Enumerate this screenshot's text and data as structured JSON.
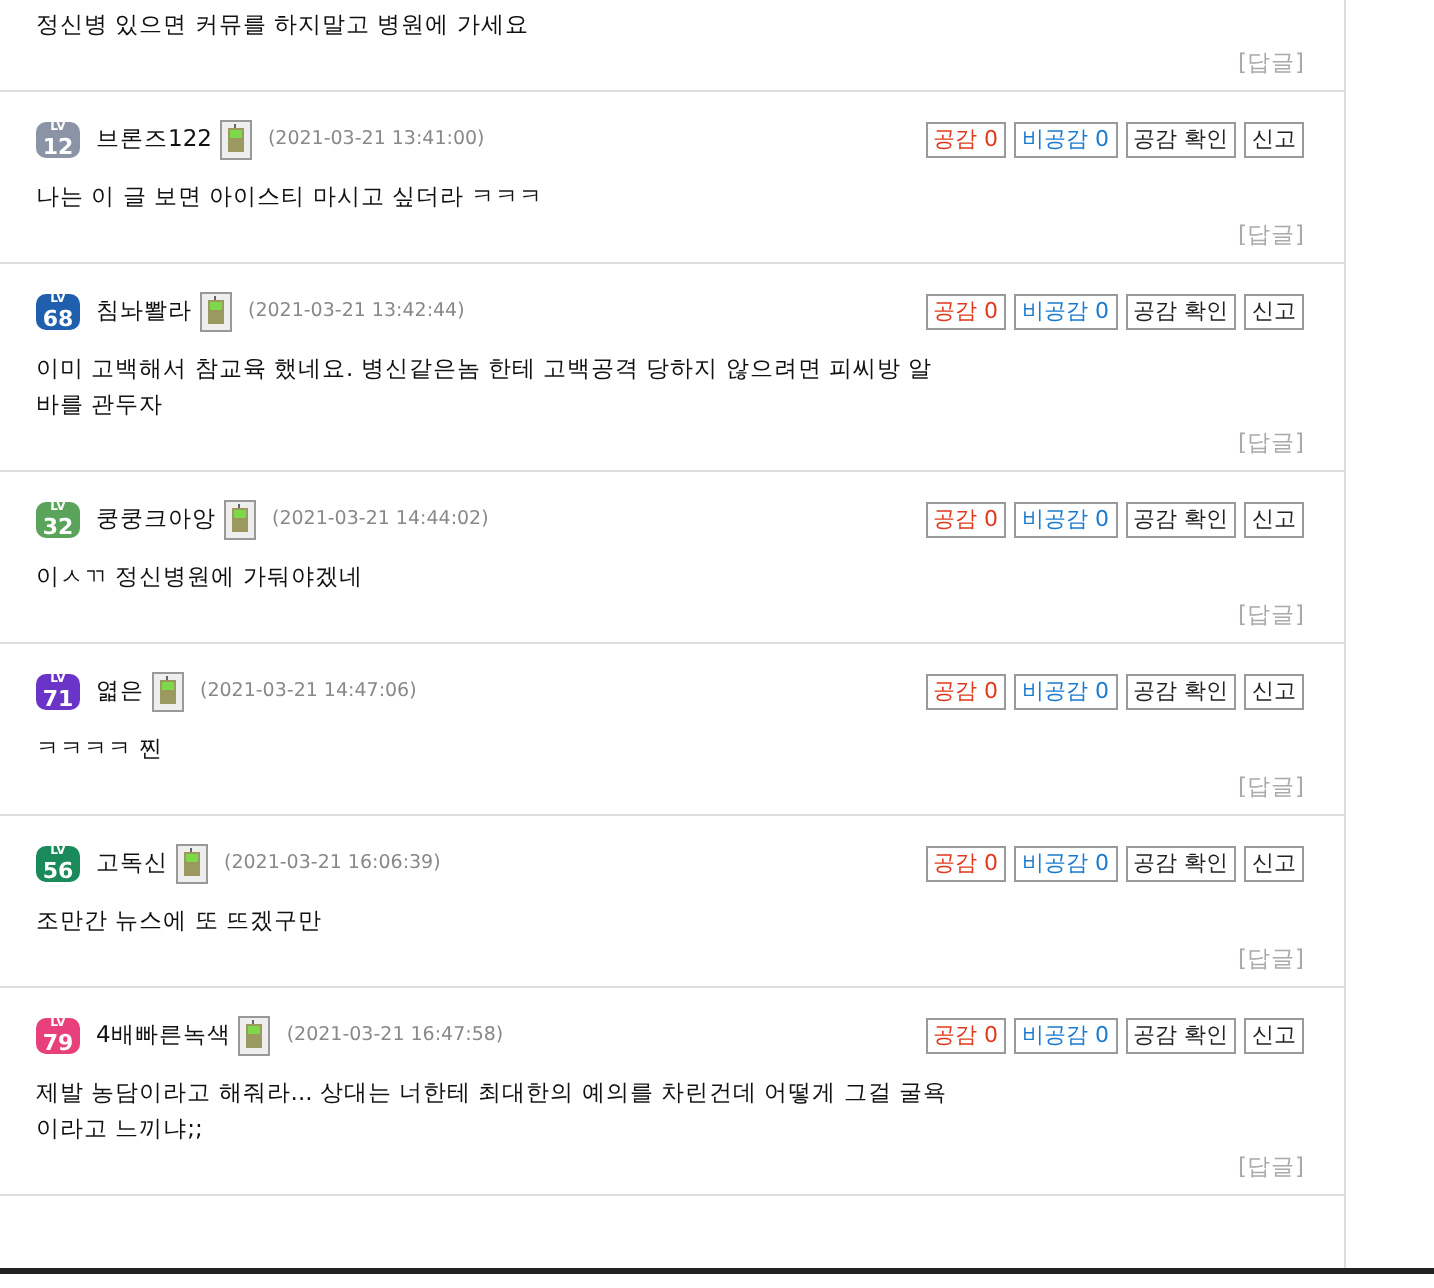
{
  "comments": [
    {
      "body": "정신병 있으면 커뮤를 하지말고 병원에 가세요",
      "reply": "[답글]"
    },
    {
      "level_tag": "LV",
      "level": "12",
      "color": "#8a94a6",
      "user": "브론즈122",
      "time": "(2021-03-21 13:41:00)",
      "body": "나는 이 글 보면 아이스티 마시고 싶더라 ㅋㅋㅋ",
      "reply": "[답글]",
      "buttons": [
        {
          "kind": "agree",
          "label": "공감 0"
        },
        {
          "kind": "disagree",
          "label": "비공감 0"
        },
        {
          "kind": "plain",
          "label": "공감 확인"
        },
        {
          "kind": "plain",
          "label": "신고"
        }
      ]
    },
    {
      "level_tag": "LV",
      "level": "68",
      "color": "#1f5fae",
      "user": "침놔뽤라",
      "time": "(2021-03-21 13:42:44)",
      "body": "이미 고백해서 참교육 했네요. 병신같은놈 한테 고백공격 당하지 않으려면 피씨방 알바를 관두자",
      "reply": "[답글]",
      "buttons": [
        {
          "kind": "agree",
          "label": "공감 0"
        },
        {
          "kind": "disagree",
          "label": "비공감 0"
        },
        {
          "kind": "plain",
          "label": "공감 확인"
        },
        {
          "kind": "plain",
          "label": "신고"
        }
      ]
    },
    {
      "level_tag": "LV",
      "level": "32",
      "color": "#5aa35a",
      "user": "쿵쿵크아앙",
      "time": "(2021-03-21 14:44:02)",
      "body": "이ㅅㄲ 정신병원에 가둬야겠네",
      "reply": "[답글]",
      "buttons": [
        {
          "kind": "agree",
          "label": "공감 0"
        },
        {
          "kind": "disagree",
          "label": "비공감 0"
        },
        {
          "kind": "plain",
          "label": "공감 확인"
        },
        {
          "kind": "plain",
          "label": "신고"
        }
      ]
    },
    {
      "level_tag": "LV",
      "level": "71",
      "color": "#6a34c8",
      "user": "엷은",
      "time": "(2021-03-21 14:47:06)",
      "body": "ㅋㅋㅋㅋ 찐",
      "reply": "[답글]",
      "buttons": [
        {
          "kind": "agree",
          "label": "공감 0"
        },
        {
          "kind": "disagree",
          "label": "비공감 0"
        },
        {
          "kind": "plain",
          "label": "공감 확인"
        },
        {
          "kind": "plain",
          "label": "신고"
        }
      ]
    },
    {
      "level_tag": "LV",
      "level": "56",
      "color": "#1a8a5a",
      "user": "고독신",
      "time": "(2021-03-21 16:06:39)",
      "body": "조만간 뉴스에 또 뜨겠구만",
      "reply": "[답글]",
      "buttons": [
        {
          "kind": "agree",
          "label": "공감 0"
        },
        {
          "kind": "disagree",
          "label": "비공감 0"
        },
        {
          "kind": "plain",
          "label": "공감 확인"
        },
        {
          "kind": "plain",
          "label": "신고"
        }
      ]
    },
    {
      "level_tag": "LV",
      "level": "79",
      "color": "#e8407a",
      "user": "4배빠른녹색",
      "time": "(2021-03-21 16:47:58)",
      "body": "제발 농담이라고 해줘라... 상대는 너한테 최대한의 예의를 차린건데 어떻게 그걸 굴욕이라고 느끼냐;;",
      "reply": "[답글]",
      "buttons": [
        {
          "kind": "agree",
          "label": "공감 0"
        },
        {
          "kind": "disagree",
          "label": "비공감 0"
        },
        {
          "kind": "plain",
          "label": "공감 확인"
        },
        {
          "kind": "plain",
          "label": "신고"
        }
      ]
    }
  ]
}
